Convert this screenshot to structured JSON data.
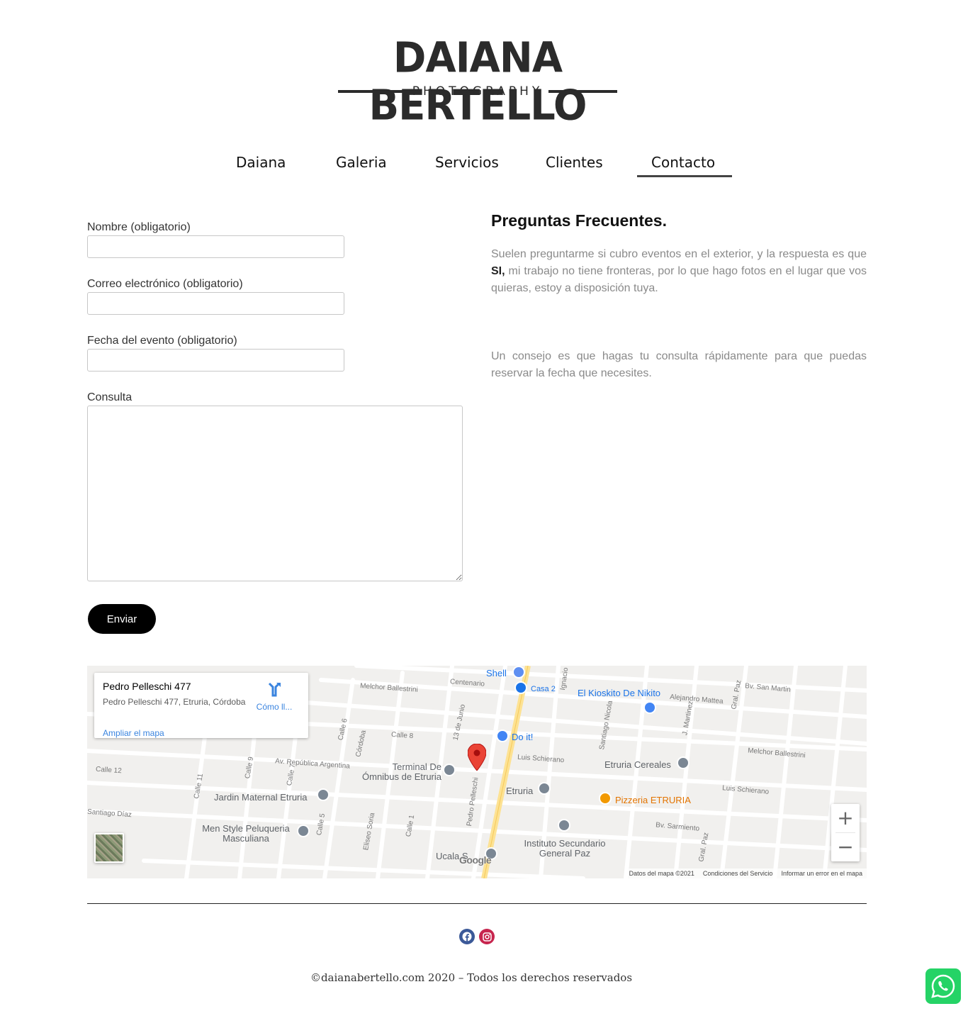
{
  "logo": {
    "name": "DAIANA BERTELLO",
    "tagline": "PHOTOGRAPHY"
  },
  "nav": {
    "items": [
      {
        "label": "Daiana"
      },
      {
        "label": "Galeria"
      },
      {
        "label": "Servicios"
      },
      {
        "label": "Clientes"
      },
      {
        "label": "Contacto"
      }
    ],
    "active": "Contacto"
  },
  "form": {
    "name_label": "Nombre (obligatorio)",
    "name_value": "",
    "email_label": "Correo electrónico (obligatorio)",
    "email_value": "",
    "date_label": "Fecha del evento (obligatorio)",
    "date_value": "",
    "message_label": "Consulta",
    "message_value": "",
    "submit_label": "Enviar"
  },
  "faq": {
    "title": "Preguntas Frecuentes.",
    "p1_before": "Suelen preguntarme si cubro eventos en el exterior, y la respuesta es que ",
    "p1_bold": "SI,",
    "p1_after": " mi trabajo no tiene fronteras, por lo que hago fotos en el lugar que vos quieras, estoy a disposición tuya.",
    "p2": "Un consejo es que hagas tu consulta rápidamente para que puedas reservar la fecha que necesites."
  },
  "map": {
    "card_title": "Pedro Pelleschi 477",
    "card_address": "Pedro Pelleschi 477, Etruria, Córdoba",
    "directions_label": "Cómo ll...",
    "expand_label": "Ampliar el mapa",
    "zoom_in": "+",
    "zoom_out": "−",
    "footer_data": "Datos del mapa ©2021",
    "footer_terms": "Condiciones del Servicio",
    "footer_report": "Informar un error en el mapa",
    "google": "Google",
    "streets": [
      "Melchor Ballestrini",
      "Centenario",
      "Bv. San Martin",
      "Alejandro Mattea",
      "Calle 8",
      "Calle 6",
      "Córdoba",
      "13 de Junio",
      "Ignacio E",
      "Santiago Nicola",
      "J. Martinez",
      "Gral. Paz",
      "Av. República Argentina",
      "Calle 12",
      "Calle 11",
      "Calle 9",
      "Calle 7",
      "Luis Schierano",
      "Santiago Díaz",
      "Calle 5",
      "Eliseo Soria",
      "Calle 1",
      "Pedro Pelleschi",
      "Bv. Sarmiento",
      "Calle"
    ],
    "pois": [
      {
        "name": "Shell",
        "kind": "blue"
      },
      {
        "name": "Casa 2",
        "kind": "blue"
      },
      {
        "name": "El Kioskito De Nikito",
        "kind": "blue"
      },
      {
        "name": "Do it!",
        "kind": "blue"
      },
      {
        "name": "Terminal De Ómnibus de Etruria",
        "kind": "gray"
      },
      {
        "name": "Etruria Cereales",
        "kind": "gray"
      },
      {
        "name": "Etruria",
        "kind": "gray"
      },
      {
        "name": "Jardin Maternal Etruria",
        "kind": "gray"
      },
      {
        "name": "Pizzeria ETRURIA",
        "kind": "orange"
      },
      {
        "name": "Men Style Peluqueria Masculiana",
        "kind": "gray"
      },
      {
        "name": "Instituto Secundario General Paz",
        "kind": "gray"
      },
      {
        "name": "Ucala S",
        "kind": "gray"
      }
    ],
    "colors": {
      "water_road": "#ffffff",
      "land": "#f1f0ee",
      "highway": "#fde293",
      "pin": "#ea4335"
    }
  },
  "footer": {
    "copyright": "©daianabertello.com 2020 – Todos los derechos reservados",
    "social": [
      {
        "icon": "facebook-icon",
        "color": "#3b5998"
      },
      {
        "icon": "instagram-icon",
        "color": "#c13584"
      }
    ],
    "whatsapp_color": "#25d366"
  }
}
